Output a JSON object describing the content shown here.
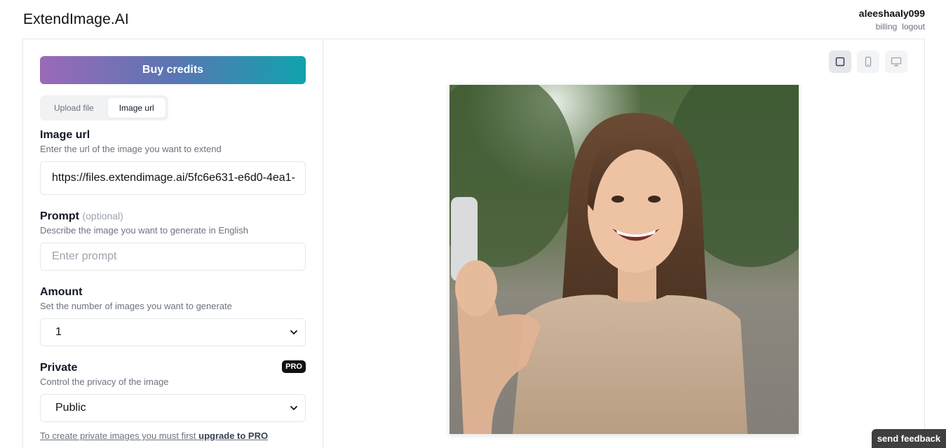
{
  "header": {
    "logo": "ExtendImage.AI",
    "username": "aleeshaaly099",
    "billing_link": "billing",
    "logout_link": "logout"
  },
  "sidebar": {
    "buy_credits": "Buy credits",
    "tabs": [
      {
        "label": "Upload file",
        "active": false
      },
      {
        "label": "Image url",
        "active": true
      }
    ],
    "image_url": {
      "label": "Image url",
      "help": "Enter the url of the image you want to extend",
      "value": "https://files.extendimage.ai/5fc6e631-e6d0-4ea1-"
    },
    "prompt": {
      "label": "Prompt",
      "optional": "(optional)",
      "help": "Describe the image you want to generate in English",
      "placeholder": "Enter prompt"
    },
    "amount": {
      "label": "Amount",
      "help": "Set the number of images you want to generate",
      "selected": "1"
    },
    "private": {
      "label": "Private",
      "badge": "PRO",
      "help": "Control the privacy of the image",
      "selected": "Public"
    },
    "upgrade_note": {
      "text": "To create private images you must first",
      "link": "upgrade to PRO"
    }
  },
  "preview": {
    "view_modes": [
      {
        "icon": "square-icon",
        "active": true
      },
      {
        "icon": "phone-icon",
        "active": false
      },
      {
        "icon": "monitor-icon",
        "active": false
      }
    ],
    "image_alt": "Smiling woman taking a selfie on a tree-lined street"
  },
  "feedback_button": "send feedback",
  "colors": {
    "gradient_start": "#9b69b8",
    "gradient_end": "#10a3ad",
    "pro_badge": "#111111",
    "feedback_bg": "#3f3f3f"
  }
}
